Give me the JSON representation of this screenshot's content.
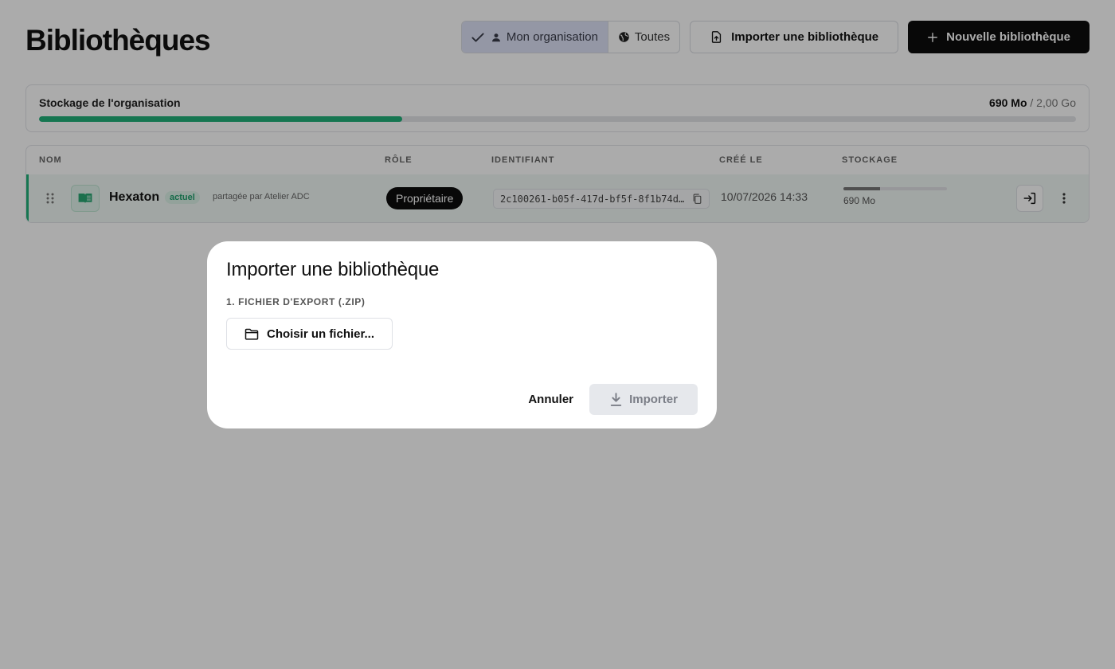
{
  "header": {
    "title": "Bibliothèques",
    "scope": {
      "options": [
        {
          "label": "Mon organisation",
          "active": true
        },
        {
          "label": "Toutes",
          "active": false
        }
      ]
    },
    "import_label": "Importer une bibliothèque",
    "new_label": "Nouvelle bibliothèque"
  },
  "storage": {
    "label": "Stockage de l'organisation",
    "used": "690 Mo",
    "separator": " / ",
    "total": "2,00 Go",
    "fraction": 0.35,
    "color": "#22b07a"
  },
  "table": {
    "columns": [
      "NOM",
      "RÔLE",
      "IDENTIFIANT",
      "CRÉÉ LE",
      "STOCKAGE"
    ],
    "rows": [
      {
        "name": "Hexaton",
        "badge": "actuel",
        "shared_by": "partagée par Atelier ADC",
        "role": "Propriétaire",
        "id": "2c100261-b05f-417d-bf5f-8f1b74d…",
        "created": "10/07/2026 14:33",
        "storage": "690 Mo",
        "storage_fraction": 0.35
      }
    ]
  },
  "modal": {
    "title": "Importer une bibliothèque",
    "step1_label": "1. FICHIER D'EXPORT (.ZIP)",
    "choose_file_label": "Choisir un fichier...",
    "cancel_label": "Annuler",
    "import_label": "Importer",
    "import_disabled": true
  },
  "icons": {
    "check": "check-icon",
    "person": "person-icon",
    "globe": "globe-icon",
    "file_upload": "file-upload-icon",
    "plus": "plus-icon",
    "drag": "drag-handle-icon",
    "book": "book-icon",
    "copy": "copy-icon",
    "enter": "enter-icon",
    "more": "more-vertical-icon",
    "folder": "folder-icon",
    "download": "download-icon"
  }
}
